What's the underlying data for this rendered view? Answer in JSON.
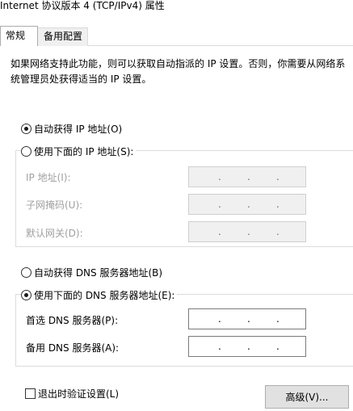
{
  "window": {
    "title": "Internet 协议版本 4 (TCP/IPv4) 属性"
  },
  "tabs": [
    {
      "label": "常规",
      "active": true
    },
    {
      "label": "备用配置",
      "active": false
    }
  ],
  "description": "如果网络支持此功能，则可以获取自动指派的 IP 设置。否则，你需要从网络系统管理员处获得适当的 IP 设置。",
  "ip": {
    "auto_label": "自动获得 IP 地址(O)",
    "auto_selected": true,
    "manual_label": "使用下面的 IP 地址(S):",
    "fields": [
      {
        "label": "IP 地址(I):",
        "value": ". . ."
      },
      {
        "label": "子网掩码(U):",
        "value": ". . ."
      },
      {
        "label": "默认网关(D):",
        "value": ". . ."
      }
    ]
  },
  "dns": {
    "auto_label": "自动获得 DNS 服务器地址(B)",
    "manual_label": "使用下面的 DNS 服务器地址(E):",
    "manual_selected": true,
    "fields": [
      {
        "label": "首选 DNS 服务器(P):",
        "value": ". . ."
      },
      {
        "label": "备用 DNS 服务器(A):",
        "value": ". . ."
      }
    ]
  },
  "validate_on_exit": {
    "label": "退出时验证设置(L)",
    "checked": false
  },
  "advanced_button": {
    "label": "高级(V)..."
  }
}
